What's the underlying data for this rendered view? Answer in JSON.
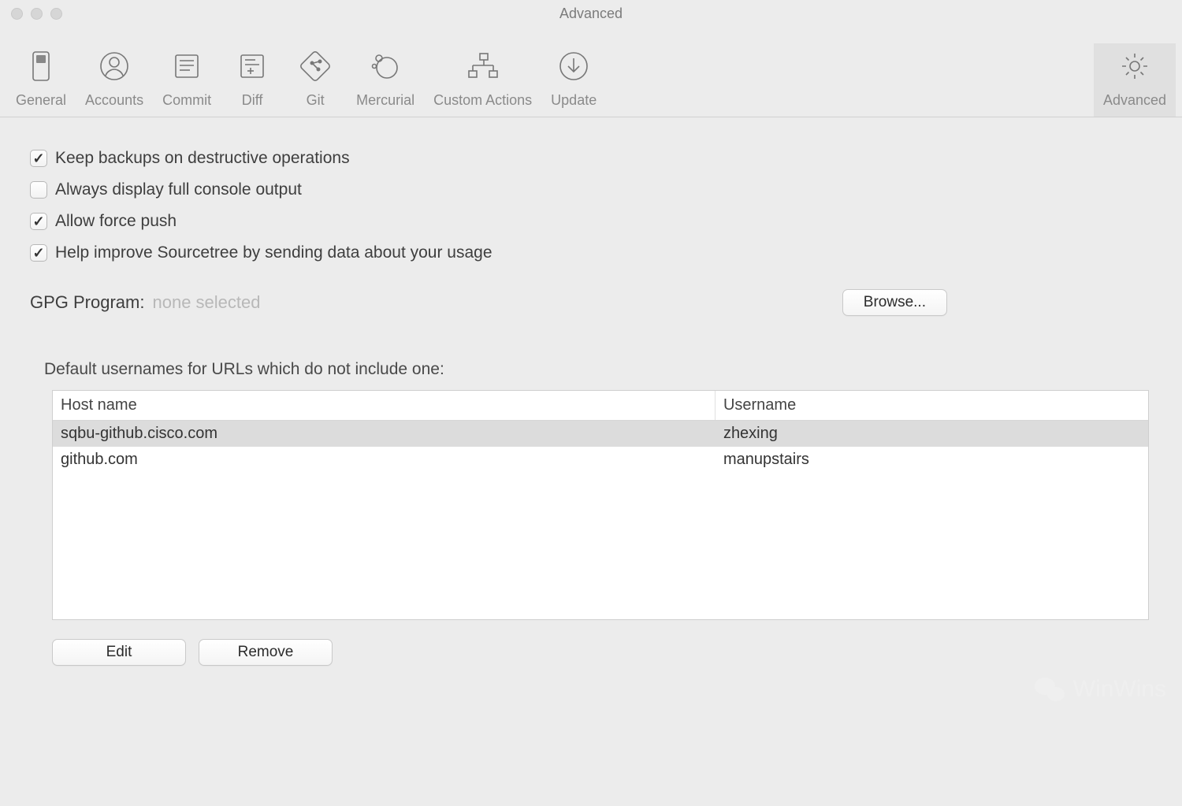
{
  "window": {
    "title": "Advanced"
  },
  "toolbar": {
    "items": [
      {
        "id": "general",
        "label": "General"
      },
      {
        "id": "accounts",
        "label": "Accounts"
      },
      {
        "id": "commit",
        "label": "Commit"
      },
      {
        "id": "diff",
        "label": "Diff"
      },
      {
        "id": "git",
        "label": "Git"
      },
      {
        "id": "mercurial",
        "label": "Mercurial"
      },
      {
        "id": "custom-actions",
        "label": "Custom Actions"
      },
      {
        "id": "update",
        "label": "Update"
      },
      {
        "id": "advanced",
        "label": "Advanced"
      }
    ]
  },
  "options": {
    "keep_backups": {
      "label": "Keep backups on destructive operations",
      "checked": true
    },
    "full_console": {
      "label": "Always display full console output",
      "checked": false
    },
    "force_push": {
      "label": "Allow force push",
      "checked": true
    },
    "help_improve": {
      "label": "Help improve Sourcetree by sending data about your usage",
      "checked": true
    }
  },
  "gpg": {
    "label": "GPG Program:",
    "value": "none selected",
    "browse_label": "Browse..."
  },
  "usernames": {
    "section_label": "Default usernames for URLs which do not include one:",
    "columns": {
      "host": "Host name",
      "user": "Username"
    },
    "rows": [
      {
        "host": "sqbu-github.cisco.com",
        "user": "zhexing",
        "selected": true
      },
      {
        "host": "github.com",
        "user": "manupstairs",
        "selected": false
      }
    ],
    "edit_label": "Edit",
    "remove_label": "Remove"
  },
  "watermark": {
    "text": "WinWins"
  }
}
